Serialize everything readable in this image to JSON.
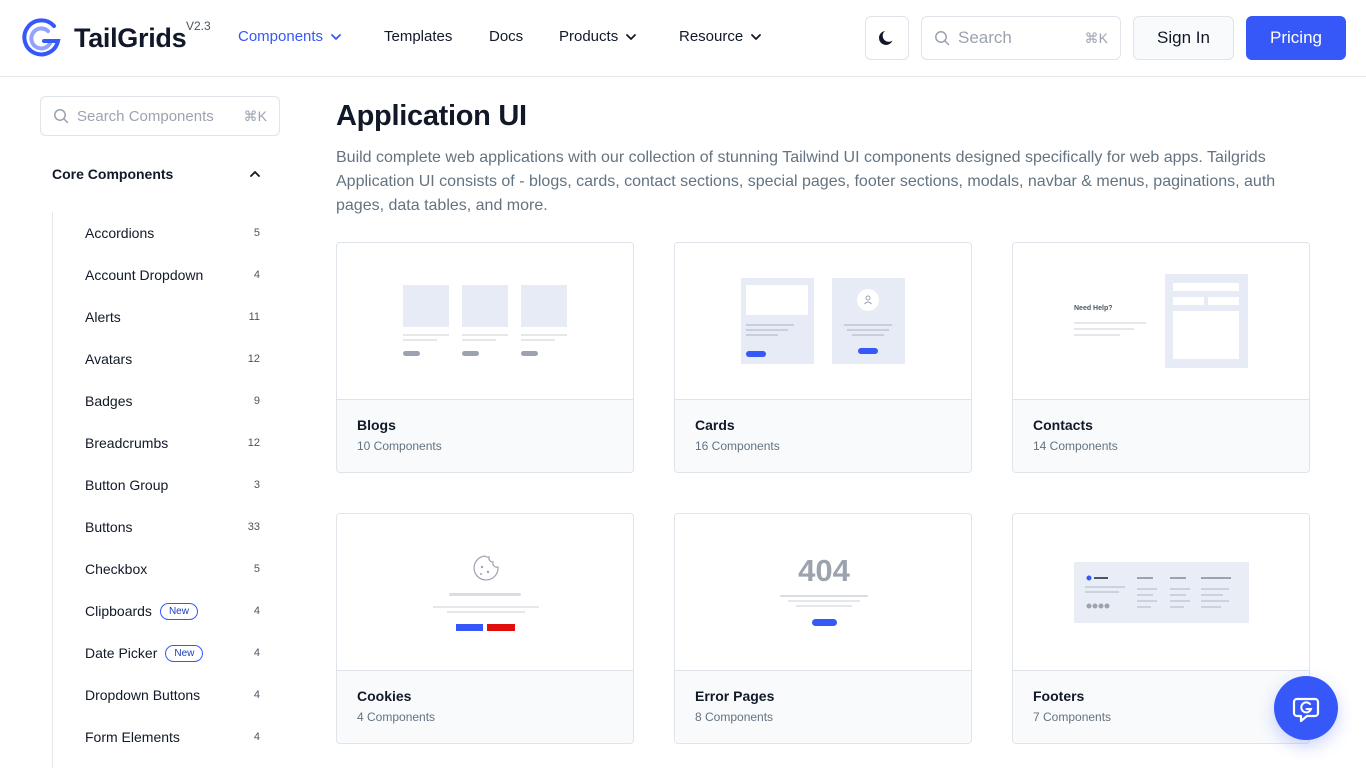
{
  "header": {
    "logo_text": "TailGrids",
    "version": "V2.3",
    "nav": [
      {
        "label": "Components",
        "has_caret": true,
        "active": true
      },
      {
        "label": "Templates",
        "has_caret": false,
        "active": false
      },
      {
        "label": "Docs",
        "has_caret": false,
        "active": false
      },
      {
        "label": "Products",
        "has_caret": true,
        "active": false
      },
      {
        "label": "Resource",
        "has_caret": true,
        "active": false
      }
    ],
    "search_placeholder": "Search",
    "search_shortcut": "⌘K",
    "signin_label": "Sign In",
    "pricing_label": "Pricing"
  },
  "sidebar": {
    "search_placeholder": "Search Components",
    "search_shortcut": "⌘K",
    "section_title": "Core Components",
    "items": [
      {
        "label": "Accordions",
        "count": "5",
        "is_new": false
      },
      {
        "label": "Account Dropdown",
        "count": "4",
        "is_new": false
      },
      {
        "label": "Alerts",
        "count": "11",
        "is_new": false
      },
      {
        "label": "Avatars",
        "count": "12",
        "is_new": false
      },
      {
        "label": "Badges",
        "count": "9",
        "is_new": false
      },
      {
        "label": "Breadcrumbs",
        "count": "12",
        "is_new": false
      },
      {
        "label": "Button Group",
        "count": "3",
        "is_new": false
      },
      {
        "label": "Buttons",
        "count": "33",
        "is_new": false
      },
      {
        "label": "Checkbox",
        "count": "5",
        "is_new": false
      },
      {
        "label": "Clipboards",
        "count": "4",
        "is_new": true
      },
      {
        "label": "Date Picker",
        "count": "4",
        "is_new": true
      },
      {
        "label": "Dropdown Buttons",
        "count": "4",
        "is_new": false
      },
      {
        "label": "Form Elements",
        "count": "4",
        "is_new": false
      }
    ],
    "new_label": "New"
  },
  "main": {
    "title": "Application UI",
    "description": "Build complete web applications with our collection of stunning Tailwind UI components designed specifically for web apps. Tailgrids Application UI consists of - blogs, cards, contact sections, special pages, footer sections, modals, navbar & menus, paginations, auth pages, data tables, and more.",
    "cards": [
      {
        "name": "Blogs",
        "count": "10 Components",
        "thumb": "blogs"
      },
      {
        "name": "Cards",
        "count": "16 Components",
        "thumb": "cards"
      },
      {
        "name": "Contacts",
        "count": "14 Components",
        "thumb": "contacts",
        "thumb_text": "Need Help?"
      },
      {
        "name": "Cookies",
        "count": "4 Components",
        "thumb": "cookies"
      },
      {
        "name": "Error Pages",
        "count": "8 Components",
        "thumb": "error",
        "thumb_text": "404"
      },
      {
        "name": "Footers",
        "count": "7 Components",
        "thumb": "footers"
      }
    ]
  },
  "colors": {
    "primary": "#3758f9",
    "text": "#111928",
    "muted": "#637381",
    "border": "#dfe4ea"
  }
}
